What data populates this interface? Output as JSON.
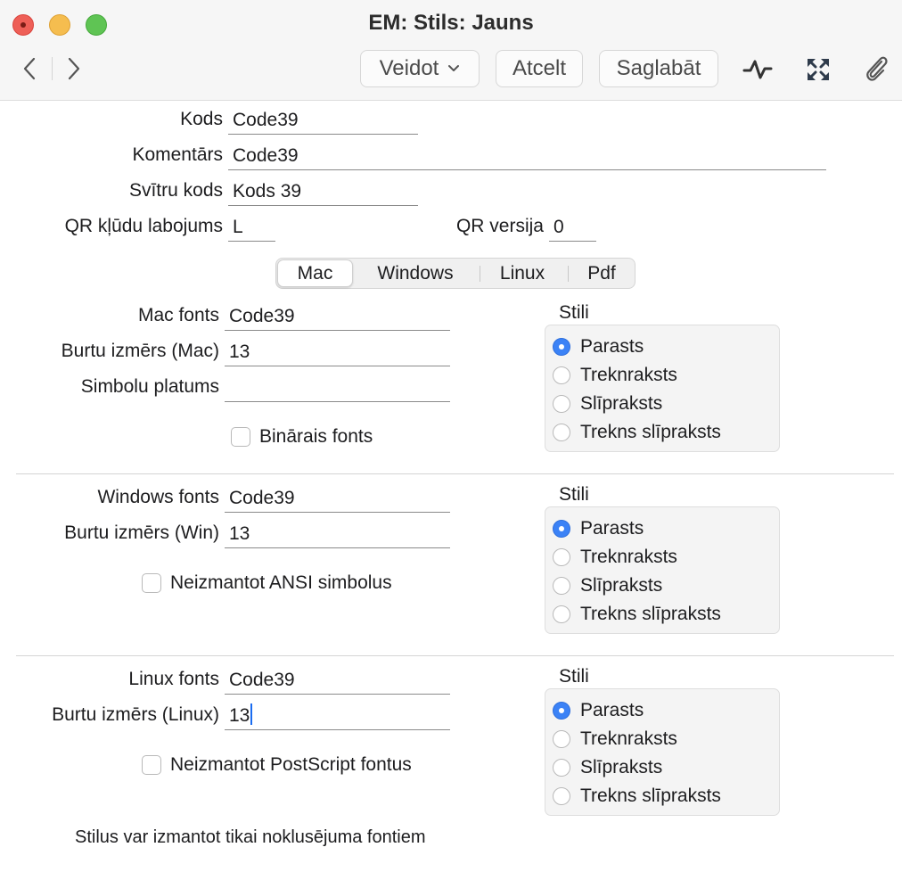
{
  "window": {
    "title": "EM: Stils: Jauns"
  },
  "toolbar": {
    "back_icon": "chevron-left-icon",
    "forward_icon": "chevron-right-icon",
    "create_label": "Veidot",
    "cancel_label": "Atcelt",
    "save_label": "Saglabāt",
    "icons": [
      "activity-icon",
      "expand-icon",
      "paperclip-icon"
    ]
  },
  "form": {
    "code_label": "Kods",
    "code_value": "Code39",
    "comment_label": "Komentārs",
    "comment_value": "Code39",
    "barcode_label": "Svītru kods",
    "barcode_value": "Kods 39",
    "qr_error_label": "QR kļūdu labojums",
    "qr_error_value": "L",
    "qr_version_label": "QR versija",
    "qr_version_value": "0"
  },
  "tabs": {
    "selected": "Mac",
    "items": [
      "Mac",
      "Windows",
      "Linux",
      "Pdf"
    ]
  },
  "mac": {
    "font_label": "Mac fonts",
    "font_value": "Code39",
    "size_label": "Burtu izmērs (Mac)",
    "size_value": "13",
    "width_label": "Simbolu platums",
    "width_value": "",
    "checkbox_label": "Binārais fonts",
    "checkbox_checked": false,
    "styles_title": "Stili",
    "selected_style": "Parasts"
  },
  "windows": {
    "font_label": "Windows fonts",
    "font_value": "Code39",
    "size_label": "Burtu izmērs (Win)",
    "size_value": "13",
    "checkbox_label": "Neizmantot ANSI simbolus",
    "checkbox_checked": false,
    "styles_title": "Stili",
    "selected_style": "Parasts"
  },
  "linux": {
    "font_label": "Linux fonts",
    "font_value": "Code39",
    "size_label": "Burtu izmērs (Linux)",
    "size_value": "13",
    "checkbox_label": "Neizmantot PostScript fontus",
    "checkbox_checked": false,
    "styles_title": "Stili",
    "selected_style": "Parasts"
  },
  "style_options": [
    "Parasts",
    "Treknraksts",
    "Slīpraksts",
    "Trekns slīpraksts"
  ],
  "footnote": "Stilus var izmantot tikai noklusējuma fontiem",
  "colors": {
    "accent": "#3b82f6",
    "caret": "#1a6cf0"
  }
}
